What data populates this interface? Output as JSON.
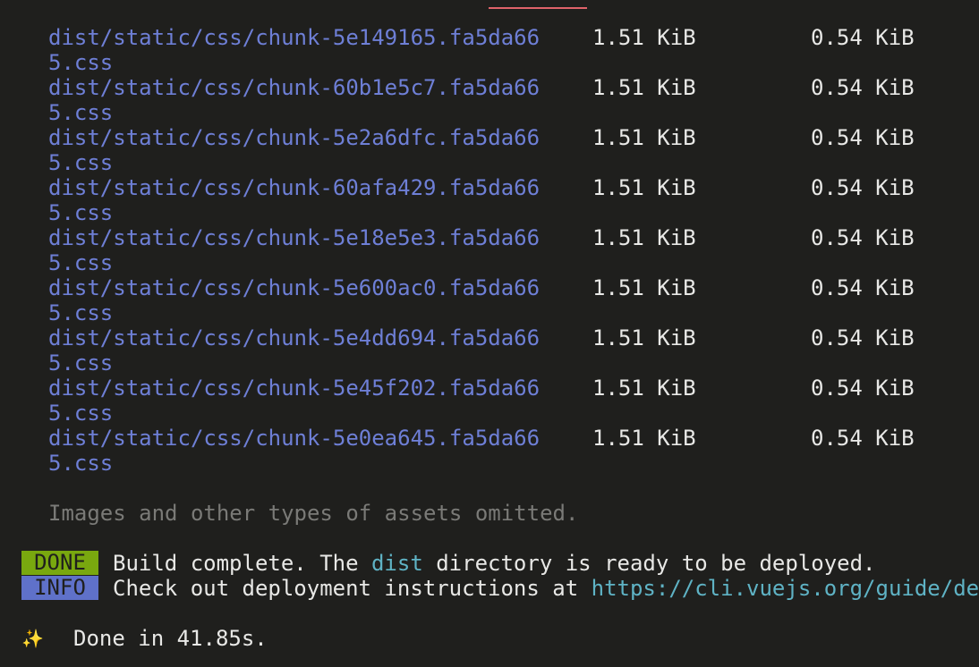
{
  "files": [
    {
      "line1": "dist/static/css/chunk-5e149165.fa5da66",
      "line2": "5.css",
      "size": "1.51 KiB",
      "gzip": "0.54 KiB"
    },
    {
      "line1": "dist/static/css/chunk-60b1e5c7.fa5da66",
      "line2": "5.css",
      "size": "1.51 KiB",
      "gzip": "0.54 KiB"
    },
    {
      "line1": "dist/static/css/chunk-5e2a6dfc.fa5da66",
      "line2": "5.css",
      "size": "1.51 KiB",
      "gzip": "0.54 KiB"
    },
    {
      "line1": "dist/static/css/chunk-60afa429.fa5da66",
      "line2": "5.css",
      "size": "1.51 KiB",
      "gzip": "0.54 KiB"
    },
    {
      "line1": "dist/static/css/chunk-5e18e5e3.fa5da66",
      "line2": "5.css",
      "size": "1.51 KiB",
      "gzip": "0.54 KiB"
    },
    {
      "line1": "dist/static/css/chunk-5e600ac0.fa5da66",
      "line2": "5.css",
      "size": "1.51 KiB",
      "gzip": "0.54 KiB"
    },
    {
      "line1": "dist/static/css/chunk-5e4dd694.fa5da66",
      "line2": "5.css",
      "size": "1.51 KiB",
      "gzip": "0.54 KiB"
    },
    {
      "line1": "dist/static/css/chunk-5e45f202.fa5da66",
      "line2": "5.css",
      "size": "1.51 KiB",
      "gzip": "0.54 KiB"
    },
    {
      "line1": "dist/static/css/chunk-5e0ea645.fa5da66",
      "line2": "5.css",
      "size": "1.51 KiB",
      "gzip": "0.54 KiB"
    }
  ],
  "omitted_note": "Images and other types of assets omitted.",
  "done_badge": "DONE",
  "done_msg_pre": "Build complete. The ",
  "done_msg_hl": "dist",
  "done_msg_post": " directory is ready to be deployed.",
  "info_badge": "INFO",
  "info_msg_pre": "Check out deployment instructions at ",
  "info_msg_link": "https://cli.vuejs.org/guide/de",
  "sparkle_icon": "✨",
  "done_time": "Done in 41.85s.",
  "colors": {
    "background": "#1f1f1d",
    "file_path": "#6e7fd6",
    "done_badge": "#79a80f",
    "info_badge": "#5f71c9",
    "highlight": "#5fb3c5",
    "muted": "#7a7a77"
  }
}
